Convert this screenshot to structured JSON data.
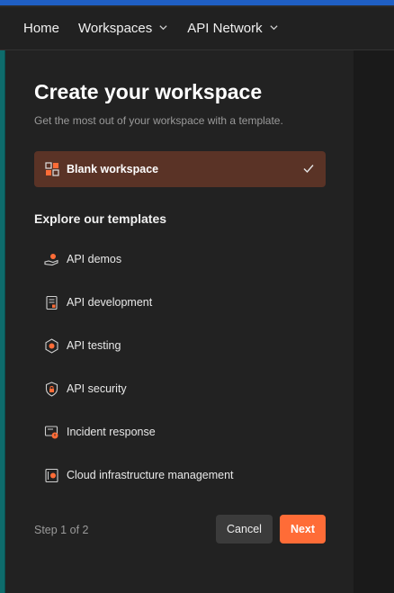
{
  "nav": {
    "home": "Home",
    "workspaces": "Workspaces",
    "api_network": "API Network"
  },
  "dialog": {
    "title": "Create your workspace",
    "subtitle": "Get the most out of your workspace with a template.",
    "blank_option": {
      "label": "Blank workspace",
      "selected": true
    },
    "templates_heading": "Explore our templates",
    "templates": [
      {
        "label": "API demos",
        "icon": "hand-holding-icon"
      },
      {
        "label": "API development",
        "icon": "spec-document-icon"
      },
      {
        "label": "API testing",
        "icon": "hexagon-gear-icon"
      },
      {
        "label": "API security",
        "icon": "shield-lock-icon"
      },
      {
        "label": "Incident response",
        "icon": "alert-monitor-icon"
      },
      {
        "label": "Cloud infrastructure management",
        "icon": "server-icon"
      }
    ],
    "step_text": "Step 1 of 2",
    "cancel_label": "Cancel",
    "next_label": "Next"
  },
  "colors": {
    "accent": "#ff6c37",
    "selected_card": "#5a3326",
    "panel_bg": "#222222"
  }
}
